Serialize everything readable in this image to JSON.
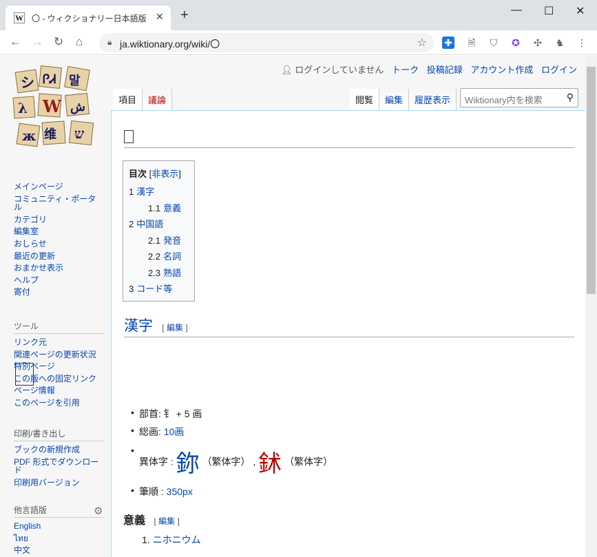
{
  "browser": {
    "tab_title": "〇 - ウィクショナリー日本語版",
    "favicon": "W",
    "new_tab": "+",
    "url": "ja.wiktionary.org/wiki/〇",
    "window": {
      "minimize": "—",
      "maximize": "☐",
      "close": "✕"
    }
  },
  "personal": {
    "anon": "ログインしていません",
    "links": [
      "トーク",
      "投稿記録",
      "アカウント作成",
      "ログイン"
    ]
  },
  "tabs": {
    "left": [
      "項目",
      "議論"
    ],
    "right": [
      "閲覧",
      "編集",
      "履歴表示"
    ]
  },
  "search": {
    "placeholder": "Wiktionary内を検索"
  },
  "sidebar": {
    "main": [
      "メインページ",
      "コミュニティ・ポータル",
      "カテゴリ",
      "編集室",
      "おしらせ",
      "最近の更新",
      "おまかせ表示",
      "ヘルプ",
      "寄付"
    ],
    "tools": {
      "title": "ツール",
      "items": [
        "リンク元",
        "関連ページの更新状況",
        "特別ページ",
        "この版への固定リンク",
        "ページ情報",
        "このページを引用"
      ]
    },
    "print": {
      "title": "印刷/書き出し",
      "items": [
        "ブックの新規作成",
        "PDF 形式でダウンロード",
        "印刷用バージョン"
      ]
    },
    "lang": {
      "title": "他言語版",
      "items": [
        "English",
        "ไทย",
        "中文"
      ]
    }
  },
  "toc": {
    "title": "目次",
    "toggle_open": "[",
    "toggle": "非表示",
    "toggle_close": "]",
    "items": [
      {
        "num": "1",
        "text": "漢字"
      },
      {
        "num": "1.1",
        "text": "意義"
      },
      {
        "num": "2",
        "text": "中国語"
      },
      {
        "num": "2.1",
        "text": "発音"
      },
      {
        "num": "2.2",
        "text": "名詞"
      },
      {
        "num": "2.3",
        "text": "熟語"
      },
      {
        "num": "3",
        "text": "コード等"
      }
    ]
  },
  "section_kanji": {
    "title": "漢字",
    "edit_open": "[",
    "edit": "編集",
    "edit_close": "]"
  },
  "kanji_info": {
    "radical_label": "部首:",
    "radical_value": "⻐ + 5 画",
    "strokes_label": "総画:",
    "strokes_value": "10画",
    "variant_label": "異体字 :",
    "variant1": "鉨",
    "variant1_note": "（繁体字）",
    "sep": ",",
    "variant2": "鉥",
    "variant2_note": "（繁体字）",
    "order_label": "筆順 :",
    "order_value": "350px"
  },
  "section_meaning": {
    "title": "意義",
    "edit_open": "[",
    "edit": "編集",
    "edit_close": "]"
  },
  "meaning_1_num": "1.",
  "meaning_1": "ニホニウム"
}
